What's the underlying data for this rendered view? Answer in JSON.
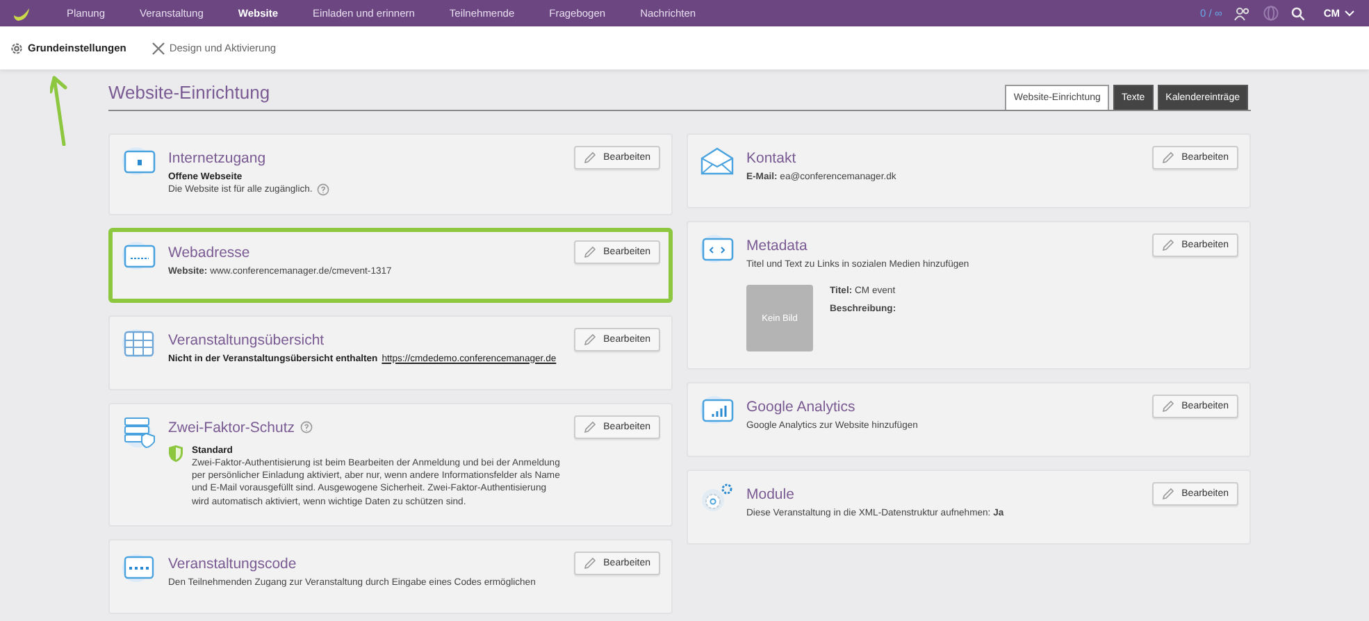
{
  "topbar": {
    "nav": [
      {
        "label": "Planung",
        "selected": false
      },
      {
        "label": "Veranstaltung",
        "selected": false
      },
      {
        "label": "Website",
        "selected": true
      },
      {
        "label": "Einladen und erinnern",
        "selected": false
      },
      {
        "label": "Teilnehmende",
        "selected": false
      },
      {
        "label": "Fragebogen",
        "selected": false
      },
      {
        "label": "Nachrichten",
        "selected": false
      }
    ],
    "counter": "0 / ∞",
    "user": "CM"
  },
  "subnav": [
    {
      "label": "Grundeinstellungen",
      "selected": true,
      "kind": "gear"
    },
    {
      "label": "Design und Aktivierung",
      "selected": false,
      "kind": "tools"
    }
  ],
  "page": {
    "title": "Website-Einrichtung",
    "tabs": [
      {
        "label": "Website-Einrichtung",
        "selected": true
      },
      {
        "label": "Texte",
        "selected": false
      },
      {
        "label": "Kalendereinträge",
        "selected": false
      }
    ],
    "left_cards": [
      {
        "title": "Internetzugang",
        "kind": "lock",
        "highlighted": false,
        "button": "Bearbeiten",
        "lines": [
          {
            "kind": "strong",
            "text": "Offene Webseite"
          },
          {
            "kind": "help",
            "text": "Die Website ist für alle zugänglich."
          }
        ]
      },
      {
        "title": "Webadresse",
        "kind": "www",
        "highlighted": true,
        "button": "Bearbeiten",
        "lines": [
          {
            "kind": "text",
            "text": "**Website:** www.conferencemanager.de/cmevent-1317"
          }
        ]
      },
      {
        "title": "Veranstaltungsübersicht",
        "kind": "grid",
        "highlighted": false,
        "button": "Bearbeiten",
        "lines": [
          {
            "kind": "link",
            "text": "Nicht in der Veranstaltungsübersicht enthalten",
            "link": "https://cmdedemo.conferencemanager.de"
          }
        ]
      },
      {
        "title": "Zwei-Faktor-Schutz",
        "kind": "server",
        "title_help": true,
        "highlighted": false,
        "button": "Bearbeiten",
        "shield": {
          "title": "Standard",
          "text": "Zwei-Faktor-Authentisierung ist beim Bearbeiten der Anmeldung und bei der Anmeldung per persönlicher Einladung aktiviert, aber nur, wenn andere Informationsfelder als Name und E-Mail vorausgefüllt sind. Ausgewogene Sicherheit. Zwei-Faktor-Authentisierung wird automatisch aktiviert, wenn wichtige Daten zu schützen sind."
        }
      },
      {
        "title": "Veranstaltungscode",
        "kind": "code",
        "highlighted": false,
        "button": "Bearbeiten",
        "lines": [
          {
            "kind": "text",
            "text": "Den Teilnehmenden Zugang zur Veranstaltung durch Eingabe eines Codes ermöglichen"
          }
        ]
      }
    ],
    "right_cards": [
      {
        "title": "Kontakt",
        "kind": "mail",
        "highlighted": false,
        "button": "Bearbeiten",
        "lines": [
          {
            "kind": "text",
            "text": "**E-Mail:** ea@conferencemanager.dk"
          }
        ]
      },
      {
        "title": "Metadata",
        "kind": "html",
        "highlighted": false,
        "button": "Bearbeiten",
        "lines": [
          {
            "kind": "text",
            "text": "Titel und Text zu Links in sozialen Medien hinzufügen"
          }
        ],
        "preview": {
          "image_label": "Kein Bild",
          "fields": [
            "**Titel:** CM event",
            "**Beschreibung:**"
          ]
        }
      },
      {
        "title": "Google Analytics",
        "kind": "chart",
        "highlighted": false,
        "button": "Bearbeiten",
        "lines": [
          {
            "kind": "text",
            "text": "Google Analytics zur Website hinzufügen"
          }
        ]
      },
      {
        "title": "Module",
        "kind": "cog",
        "highlighted": false,
        "button": "Bearbeiten",
        "lines": [
          {
            "kind": "text",
            "text": "Diese Veranstaltung in die XML-Datenstruktur aufnehmen: **Ja**"
          }
        ]
      }
    ]
  }
}
